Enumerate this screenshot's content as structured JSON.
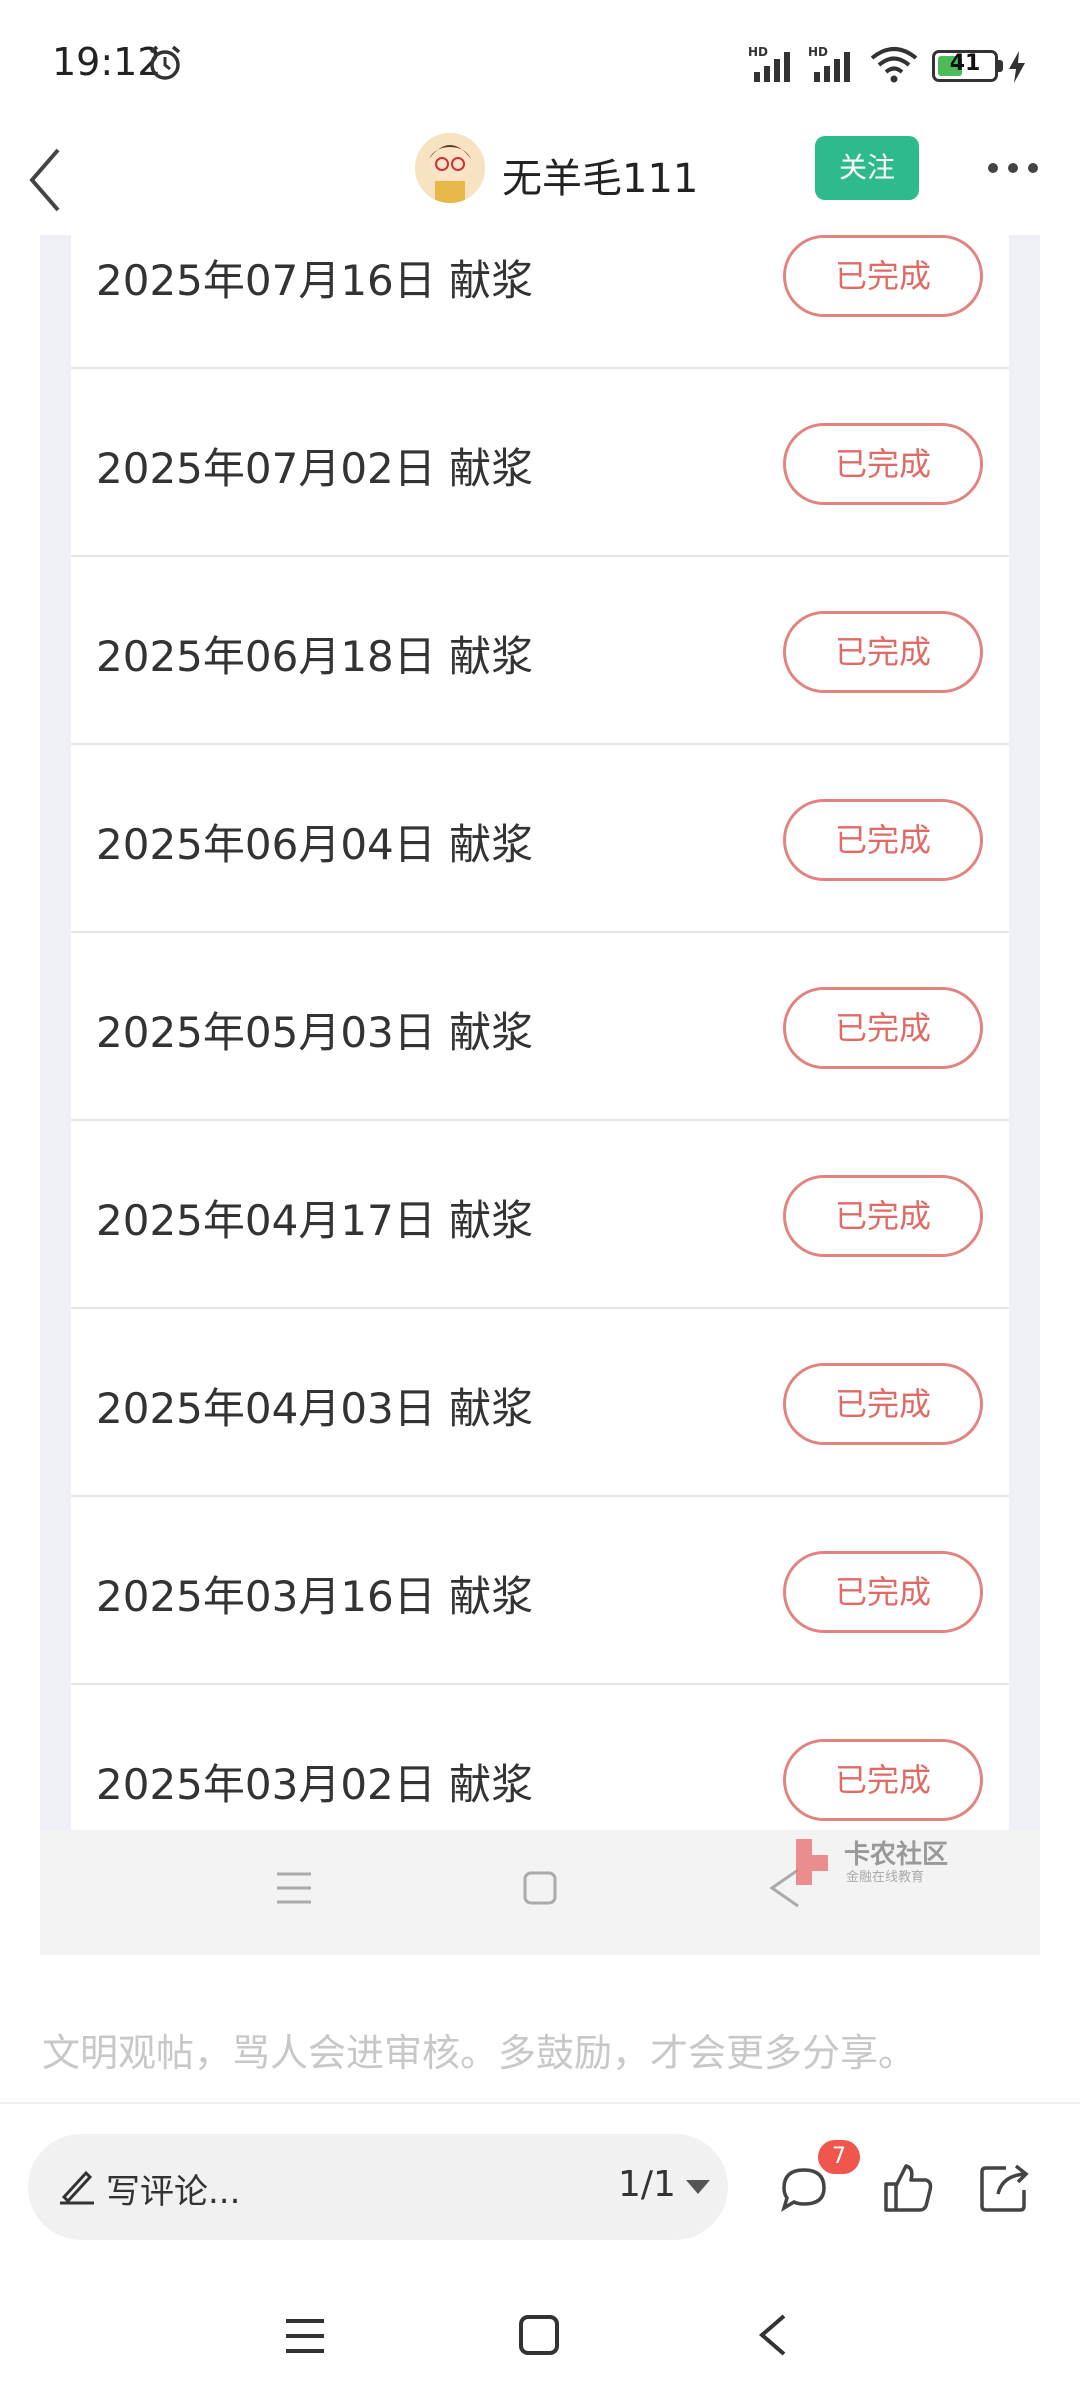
{
  "status_bar": {
    "time": "19:12",
    "battery_level": "41",
    "network_label_1": "HD",
    "network_label_2": "HD",
    "icons": [
      "alarm-icon",
      "signal-icon",
      "wifi-icon",
      "battery-icon",
      "charging-icon"
    ]
  },
  "header": {
    "username": "无羊毛111",
    "follow_label": "关注",
    "icons": [
      "back-arrow-icon",
      "more-icon"
    ]
  },
  "records": [
    {
      "label": "2025年07月16日 献浆",
      "status": "已完成"
    },
    {
      "label": "2025年07月02日 献浆",
      "status": "已完成"
    },
    {
      "label": "2025年06月18日 献浆",
      "status": "已完成"
    },
    {
      "label": "2025年06月04日 献浆",
      "status": "已完成"
    },
    {
      "label": "2025年05月03日 献浆",
      "status": "已完成"
    },
    {
      "label": "2025年04月17日 献浆",
      "status": "已完成"
    },
    {
      "label": "2025年04月03日 献浆",
      "status": "已完成"
    },
    {
      "label": "2025年03月16日 献浆",
      "status": "已完成"
    },
    {
      "label": "2025年03月02日 献浆",
      "status": "已完成"
    }
  ],
  "watermark": {
    "title": "卡农社区",
    "subtitle": "金融在线教育"
  },
  "tip_text": "文明观帖，骂人会进审核。多鼓励，才会更多分享。",
  "comment_bar": {
    "placeholder": "写评论...",
    "page_indicator": "1/1",
    "comment_count": "7"
  },
  "colors": {
    "follow_button": "#2fba8e",
    "status_border": "#e2837f",
    "status_text": "#e06b66",
    "badge": "#f0564e"
  }
}
